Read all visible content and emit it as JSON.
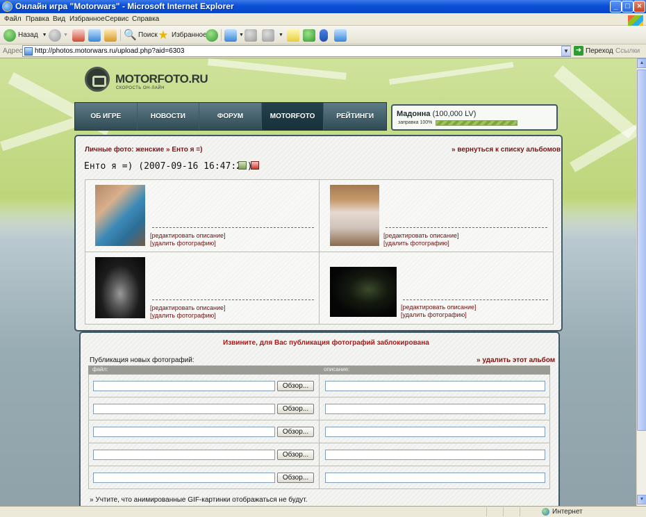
{
  "window": {
    "title": "Онлайн игра \"Motorwars\" - Microsoft Internet Explorer",
    "minimize_label": "_",
    "maximize_label": "□",
    "close_label": "×"
  },
  "menu": [
    "Файл",
    "Правка",
    "Вид",
    "Избранное",
    "Сервис",
    "Справка"
  ],
  "toolbar": {
    "back_label": "Назад",
    "search_label": "Поиск",
    "favorites_label": "Избранное"
  },
  "address": {
    "label": "Адрес:",
    "url": "http://photos.motorwars.ru/upload.php?aid=6303",
    "go_label": "Переход",
    "links_label": "Ссылки"
  },
  "site": {
    "logo_text": "MOTORFOTO.RU",
    "logo_sub": "СКОРОСТЬ ОН-ЛАЙН",
    "nav": [
      {
        "label": "ОБ ИГРЕ",
        "active": false
      },
      {
        "label": "НОВОСТИ",
        "active": false
      },
      {
        "label": "ФОРУМ",
        "active": false
      },
      {
        "label": "MOTORFOTO",
        "active": true
      },
      {
        "label": "РЕЙТИНГИ",
        "active": false
      }
    ],
    "player": {
      "name": "Мадонна",
      "level": "(100,000 LV)",
      "fuel_label": "заправка 100%",
      "fuel_percent": 100
    }
  },
  "album": {
    "breadcrumb": {
      "section": "Личные фото: женские",
      "separator": "»",
      "album": "Енто я =)"
    },
    "back_link": "» вернуться к списку альбомов",
    "title": "Енто я =) (2007-09-16 16:47:21)",
    "photos": [
      {
        "edit_label": "[редактировать описание]",
        "delete_label": "[удалить фотографию]"
      },
      {
        "edit_label": "[редактировать описание]",
        "delete_label": "[удалить фотографию]"
      },
      {
        "edit_label": "[редактировать описание]",
        "delete_label": "[удалить фотографию]"
      },
      {
        "edit_label": "[редактировать описание]",
        "delete_label": "[удалить фотографию]"
      }
    ]
  },
  "upload": {
    "blocked_message": "Извините, для Вас публикация фотографий заблокирована",
    "section_label": "Публикация новых фотографий:",
    "delete_album_label": "» удалить этот альбом",
    "col_file": "файл:",
    "col_desc": "описание:",
    "browse_label": "Обзор...",
    "rows": 5,
    "note": "» Учтите, что анимированные GIF-картинки отображаться не будут."
  },
  "status": {
    "zone": "Интернет"
  }
}
